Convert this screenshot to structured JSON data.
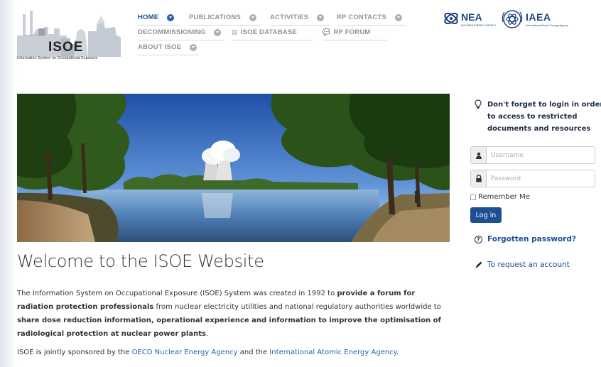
{
  "logo": {
    "text": "ISOE",
    "tagline": "Information System on Occupational Exposure"
  },
  "nav": {
    "home": "HOME",
    "publications": "PUBLICATIONS",
    "activities": "ACTIVITIES",
    "rp_contacts": "RP CONTACTS",
    "decommissioning": "DECOMMISSIONING",
    "isoe_database": "ISOE DATABASE",
    "rp_forum": "RP FORUM",
    "about_isoe": "ABOUT ISOE"
  },
  "partners": {
    "nea_name": "NEA",
    "nea_full": "NUCLEAR ENERGY AGENCY",
    "iaea_name": "IAEA",
    "iaea_full": "International Atomic Energy Agency"
  },
  "main": {
    "welcome_title": "Welcome to the ISOE Website",
    "intro_1": "The Information System on Occupational Exposure (ISOE) System was created in 1992 to ",
    "intro_2_bold": "provide a forum for radiation protection professionals",
    "intro_3": " from nuclear electricity utilities and national regulatory authorities worldwide to ",
    "intro_4_bold": "share dose reduction information, operational experience and information to improve the optimisation of radiological protection at nuclear power plants",
    "intro_5": ".",
    "sponsor_1": "ISOE is jointly sponsored by the ",
    "sponsor_link_1": "OECD Nuclear Energy Agency",
    "sponsor_2": " and the ",
    "sponsor_link_2": "International Atomic Energy Agency",
    "sponsor_3": "."
  },
  "login": {
    "note": "Don't forget to login in order to access to restricted documents and resources",
    "username_placeholder": "Username",
    "password_placeholder": "Password",
    "remember_label": "Remember Me",
    "button_label": "Log in",
    "forgot_label": "Forgotten password?",
    "request_label": "To request an account"
  },
  "colors": {
    "nav_active": "#1d4d8f",
    "nav_inactive": "#8e949c",
    "link": "#2a5fb0",
    "button": "#1d4f94"
  },
  "icons": [
    "lightbulb-icon",
    "user-icon",
    "lock-icon",
    "question-circle-icon",
    "pencil-icon",
    "database-icon",
    "comment-icon",
    "chevron-down-icon"
  ]
}
